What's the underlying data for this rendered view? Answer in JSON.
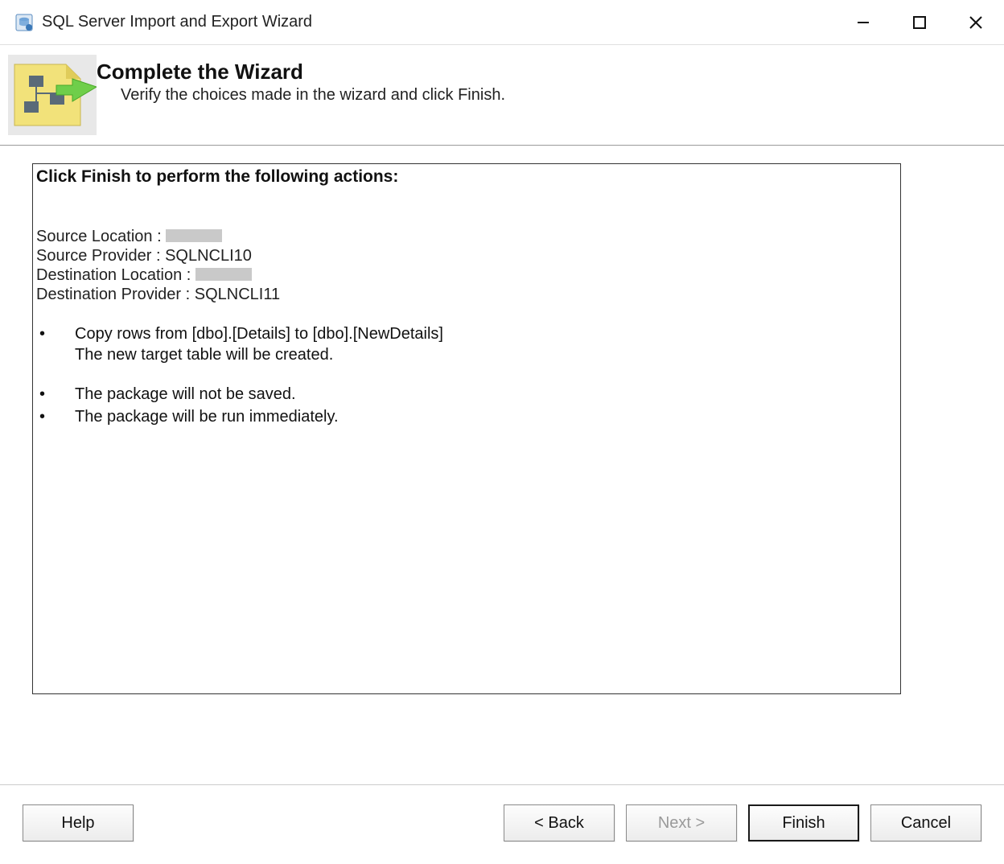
{
  "window": {
    "title": "SQL Server Import and Export Wizard"
  },
  "header": {
    "title": "Complete the Wizard",
    "subtitle": "Verify the choices made in the wizard and click Finish."
  },
  "summary": {
    "heading": "Click Finish to perform the following actions:",
    "source_location_label": "Source Location :",
    "source_location_value": "",
    "source_provider_label": "Source Provider :",
    "source_provider_value": "SQLNCLI10",
    "dest_location_label": "Destination Location :",
    "dest_location_value": "",
    "dest_provider_label": "Destination Provider :",
    "dest_provider_value": "SQLNCLI11",
    "bullets": [
      "Copy rows from [dbo].[Details] to [dbo].[NewDetails]",
      "The package will not be saved.",
      "The package will be run immediately."
    ],
    "sub_line": "The new target table will be created."
  },
  "buttons": {
    "help": "Help",
    "back": "< Back",
    "next": "Next >",
    "finish": "Finish",
    "cancel": "Cancel"
  }
}
